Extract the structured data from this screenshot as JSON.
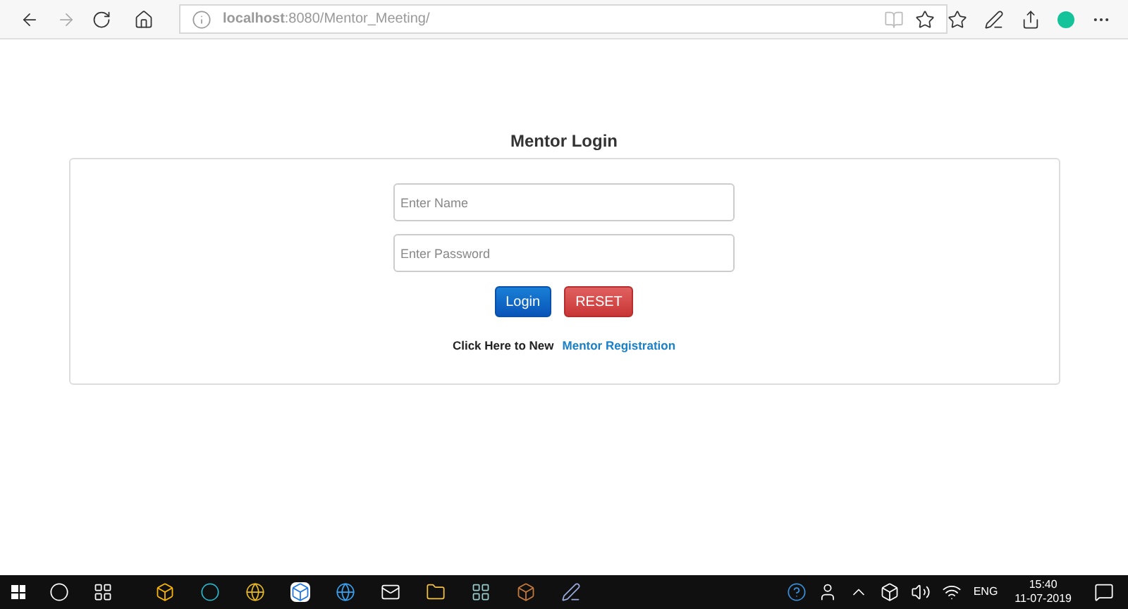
{
  "browser": {
    "url": "**localhost**:8080/Mentor_Meeting/"
  },
  "login": {
    "title": "Mentor Login",
    "fields": [
      {
        "placeholder": "Enter Name"
      },
      {
        "placeholder": "Enter Password"
      }
    ],
    "buttons": [
      {
        "label": "Login",
        "kind": "primary"
      },
      {
        "label": "RESET",
        "kind": "danger"
      }
    ],
    "prompt": "Click Here to New",
    "link": "Mentor Registration"
  },
  "taskbar": {
    "language": "ENG",
    "time": "15:40",
    "date": "11-07-2019"
  }
}
